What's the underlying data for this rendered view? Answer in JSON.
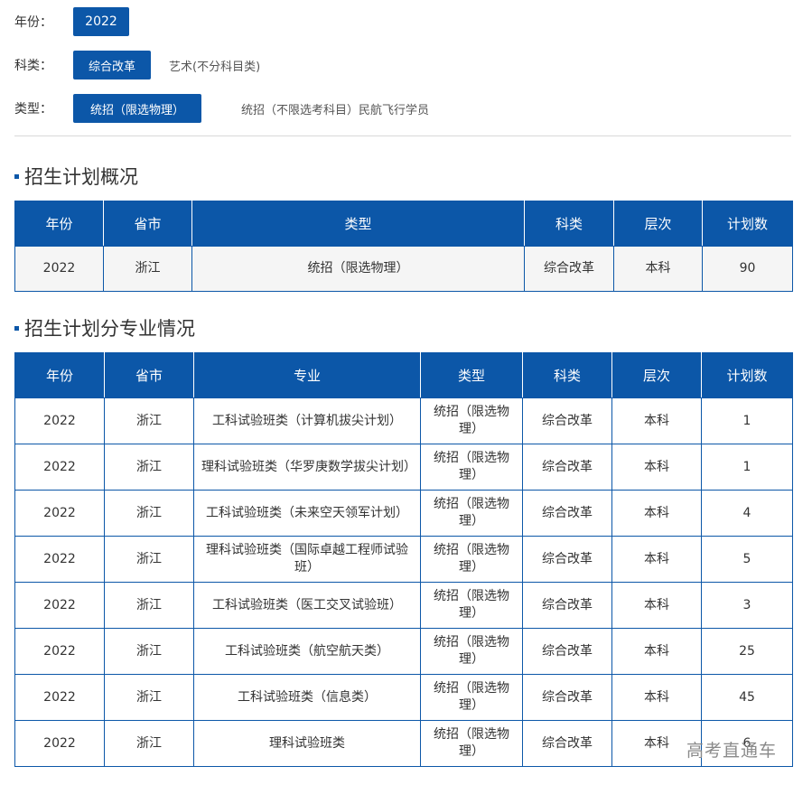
{
  "filters": {
    "year": {
      "label": "年份：",
      "options": [
        "2022"
      ]
    },
    "subject": {
      "label": "科类：",
      "options": [
        "综合改革",
        "艺术(不分科目类)"
      ]
    },
    "type": {
      "label": "类型：",
      "options": [
        "统招（限选物理）",
        "统招（不限选考科目）",
        "民航飞行学员"
      ]
    }
  },
  "overview": {
    "title": "招生计划概况",
    "headers": [
      "年份",
      "省市",
      "类型",
      "科类",
      "层次",
      "计划数"
    ],
    "rows": [
      [
        "2022",
        "浙江",
        "统招（限选物理）",
        "综合改革",
        "本科",
        "90"
      ]
    ]
  },
  "majors": {
    "title": "招生计划分专业情况",
    "headers": [
      "年份",
      "省市",
      "专业",
      "类型",
      "科类",
      "层次",
      "计划数"
    ],
    "rows": [
      [
        "2022",
        "浙江",
        "工科试验班类（计算机拔尖计划）",
        "统招（限选物理）",
        "综合改革",
        "本科",
        "1"
      ],
      [
        "2022",
        "浙江",
        "理科试验班类（华罗庚数学拔尖计划）",
        "统招（限选物理）",
        "综合改革",
        "本科",
        "1"
      ],
      [
        "2022",
        "浙江",
        "工科试验班类（未来空天领军计划）",
        "统招（限选物理）",
        "综合改革",
        "本科",
        "4"
      ],
      [
        "2022",
        "浙江",
        "理科试验班类（国际卓越工程师试验班）",
        "统招（限选物理）",
        "综合改革",
        "本科",
        "5"
      ],
      [
        "2022",
        "浙江",
        "工科试验班类（医工交叉试验班）",
        "统招（限选物理）",
        "综合改革",
        "本科",
        "3"
      ],
      [
        "2022",
        "浙江",
        "工科试验班类（航空航天类）",
        "统招（限选物理）",
        "综合改革",
        "本科",
        "25"
      ],
      [
        "2022",
        "浙江",
        "工科试验班类（信息类）",
        "统招（限选物理）",
        "综合改革",
        "本科",
        "45"
      ],
      [
        "2022",
        "浙江",
        "理科试验班类",
        "统招（限选物理）",
        "综合改革",
        "本科",
        "6"
      ]
    ]
  },
  "watermark": "高考直通车",
  "colors": {
    "accent": "#0c57a8"
  }
}
